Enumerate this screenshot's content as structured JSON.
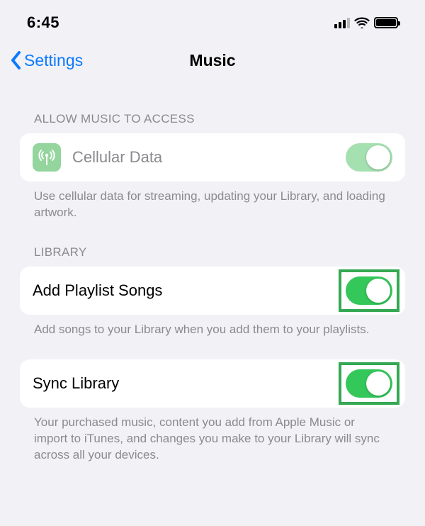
{
  "status": {
    "time": "6:45"
  },
  "nav": {
    "back_label": "Settings",
    "title": "Music"
  },
  "sections": {
    "access": {
      "header": "Allow Music to Access",
      "cellular": {
        "label": "Cellular Data",
        "on": true,
        "footer": "Use cellular data for streaming, updating your Library, and loading artwork."
      }
    },
    "library": {
      "header": "Library",
      "add_playlist": {
        "label": "Add Playlist Songs",
        "on": true,
        "footer": "Add songs to your Library when you add them to your playlists."
      },
      "sync": {
        "label": "Sync Library",
        "on": true,
        "footer": "Your purchased music, content you add from Apple Music or import to iTunes, and changes you make to your Library will sync across all your devices."
      }
    }
  }
}
